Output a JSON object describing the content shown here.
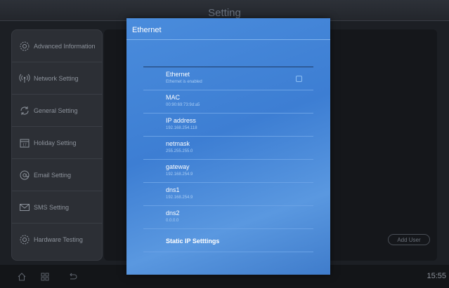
{
  "app": {
    "title": "Setting"
  },
  "sidebar": {
    "items": [
      {
        "label": "Advanced Information",
        "icon": "gear-icon"
      },
      {
        "label": "Network Setting",
        "icon": "wireless-icon"
      },
      {
        "label": "General Setting",
        "icon": "refresh-icon"
      },
      {
        "label": "Holiday Setting",
        "icon": "calendar-icon"
      },
      {
        "label": "Email Setting",
        "icon": "at-icon"
      },
      {
        "label": "SMS Setting",
        "icon": "envelope-icon"
      },
      {
        "label": "Hardware Testing",
        "icon": "gear-icon"
      }
    ]
  },
  "content": {
    "add_user_label": "Add User"
  },
  "bottombar": {
    "clock": "15:55",
    "icons": [
      "home-icon",
      "apps-icon",
      "back-icon"
    ]
  },
  "dialog": {
    "title": "Ethernet",
    "rows": [
      {
        "label": "Ethernet",
        "value": "Ethernet is enabled",
        "checked": true
      },
      {
        "label": "MAC",
        "value": "00:90:69:73:9d:a5"
      },
      {
        "label": "IP address",
        "value": "192.168.254.118"
      },
      {
        "label": "netmask",
        "value": "255.255.255.0"
      },
      {
        "label": "gateway",
        "value": "192.168.254.9"
      },
      {
        "label": "dns1",
        "value": "192.168.254.9"
      },
      {
        "label": "dns2",
        "value": "0.0.0.0"
      }
    ],
    "static_ip_label": "Static IP Setttings"
  },
  "colors": {
    "dialog_blue": "#4a8cdc",
    "background": "#1c1f24",
    "sidebar": "#2c2f35"
  }
}
